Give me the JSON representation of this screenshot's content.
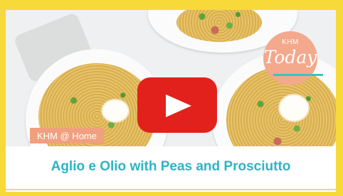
{
  "video": {
    "tag_label": "KHM @ Home",
    "badge_top": "KHM",
    "badge_script": "Today",
    "title": "Aglio e Olio with Peas and Prosciutto"
  },
  "colors": {
    "page_background": "#f7d93a",
    "title": "#2fb3c4",
    "tag_background": "#f0a07f",
    "badge_background": "#f4a88c",
    "play_button": "#e2211c"
  },
  "icons": {
    "play": "play-triangle-icon"
  }
}
